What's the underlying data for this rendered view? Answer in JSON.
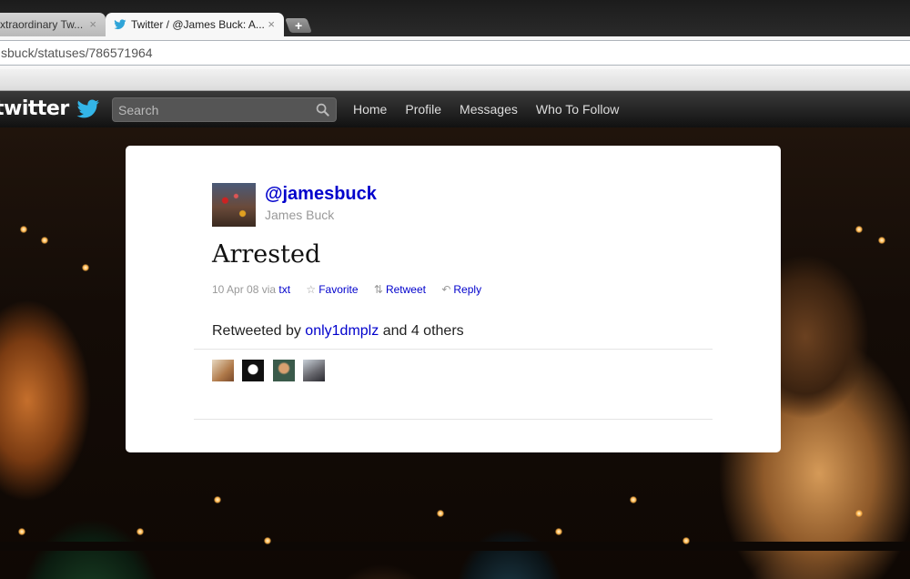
{
  "browser": {
    "tabs": [
      {
        "label": "xtraordinary Tw...",
        "close": "×"
      },
      {
        "label": "Twitter / @James Buck: A...",
        "close": "×",
        "favicon": "twitter-bird-icon"
      }
    ],
    "new_tab_label": "+",
    "url": "sbuck/statuses/786571964"
  },
  "topbar": {
    "logo_text": "twitter",
    "search_placeholder": "Search",
    "nav": [
      "Home",
      "Profile",
      "Messages",
      "Who To Follow"
    ]
  },
  "tweet": {
    "screen_name": "@jamesbuck",
    "full_name": "James Buck",
    "text": "Arrested",
    "date": "10 Apr 08",
    "via_label": "via",
    "source": "txt",
    "actions": {
      "favorite": {
        "icon": "☆",
        "label": "Favorite"
      },
      "retweet": {
        "icon": "⇅",
        "label": "Retweet"
      },
      "reply": {
        "icon": "↶",
        "label": "Reply"
      }
    },
    "retweeted_by": {
      "prefix": "Retweeted by",
      "user": "only1dmplz",
      "suffix": "and 4 others"
    }
  },
  "colors": {
    "link": "#0000cc",
    "twitter_blue": "#1da1f2",
    "topbar": "#1a1a1a"
  }
}
